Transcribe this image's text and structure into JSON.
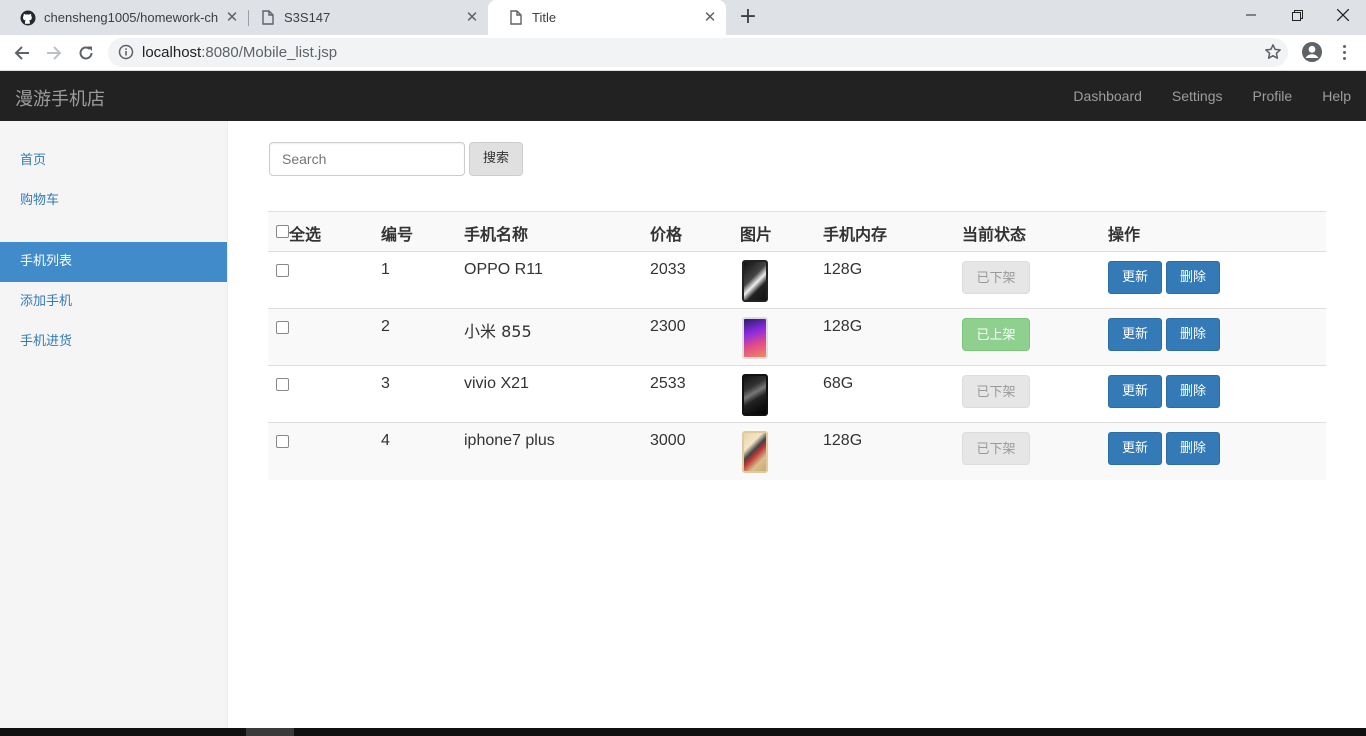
{
  "browser": {
    "tabs": [
      {
        "label": "chensheng1005/homework-ch",
        "icon": "github-icon"
      },
      {
        "label": "S3S147",
        "icon": "page-icon"
      },
      {
        "label": "Title",
        "icon": "page-icon"
      }
    ],
    "url_host": "localhost",
    "url_rest": ":8080/Mobile_list.jsp"
  },
  "app": {
    "brand": "漫游手机店",
    "nav": [
      "Dashboard",
      "Settings",
      "Profile",
      "Help"
    ]
  },
  "sidebar": {
    "items": [
      {
        "label": "首页"
      },
      {
        "label": "购物车"
      },
      {
        "label": "手机列表"
      },
      {
        "label": "添加手机"
      },
      {
        "label": "手机进货"
      }
    ]
  },
  "search": {
    "placeholder": "Search",
    "button": "搜索"
  },
  "table": {
    "headers": {
      "select_all": "全选",
      "id": "编号",
      "name": "手机名称",
      "price": "价格",
      "image": "图片",
      "memory": "手机内存",
      "status": "当前状态",
      "actions": "操作"
    },
    "rows": [
      {
        "id": "1",
        "name": "OPPO R11",
        "price": "2033",
        "memory": "128G",
        "status": "已下架",
        "on_shelf": false
      },
      {
        "id": "2",
        "name": "小米 855",
        "price": "2300",
        "memory": "128G",
        "status": "已上架",
        "on_shelf": true
      },
      {
        "id": "3",
        "name": "vivio X21",
        "price": "2533",
        "memory": "68G",
        "status": "已下架",
        "on_shelf": false
      },
      {
        "id": "4",
        "name": "iphone7 plus",
        "price": "3000",
        "memory": "128G",
        "status": "已下架",
        "on_shelf": false
      }
    ],
    "update_label": "更新",
    "delete_label": "删除"
  },
  "colors": {
    "primary": "#337ab7",
    "active_nav": "#428bca",
    "navbar": "#222222",
    "on_shelf": "#8fd08f"
  }
}
